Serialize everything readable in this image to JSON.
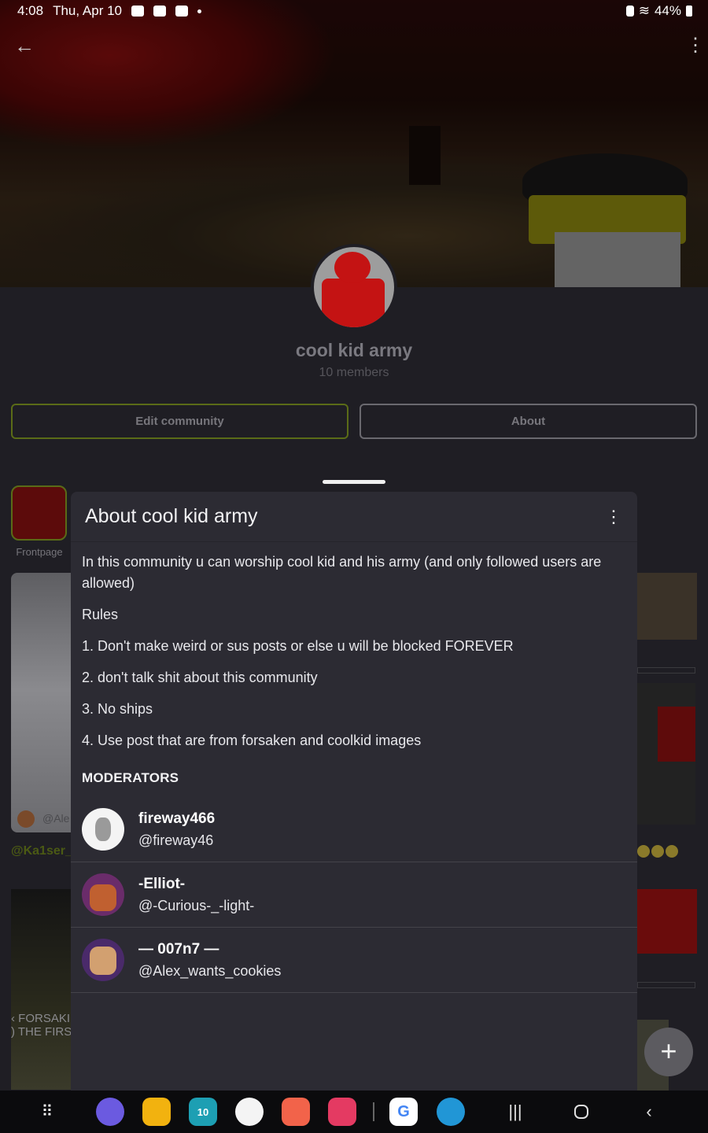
{
  "status_bar": {
    "time": "4:08",
    "date": "Thu, Apr 10",
    "battery": "44%"
  },
  "community": {
    "name": "cool kid army",
    "members": "10 members",
    "edit_button": "Edit community",
    "about_button": "About"
  },
  "background": {
    "frontpage_label": "Frontpage",
    "card_user": "@Ale",
    "kaiser_user": "@Ka1ser_",
    "forsaken_line1": "‹ FORSAKI",
    "forsaken_line2": ") THE FIRS"
  },
  "sheet": {
    "title": "About cool kid army",
    "description": "In this community u can worship cool kid and his army (and only followed users are allowed)",
    "rules_heading": "Rules",
    "rules": [
      "1. Don't make weird or sus posts or else u will be blocked FOREVER",
      "2. don't talk shit about this community",
      "3. No ships",
      "4. Use post that are from forsaken and coolkid images"
    ],
    "moderators_heading": "MODERATORS",
    "moderators": [
      {
        "name": "fireway466",
        "handle": "@fireway46"
      },
      {
        "name": "-Elliot-",
        "handle": "@-Curious-_-light-"
      },
      {
        "name": "— 007n7 —",
        "handle": "@Alex_wants_cookies"
      }
    ]
  },
  "dock": {
    "calendar_day": "10"
  },
  "colors": {
    "accent_border": "#5a6b17",
    "sheet_bg": "#2c2b33",
    "page_bg": "#1f1e24"
  }
}
